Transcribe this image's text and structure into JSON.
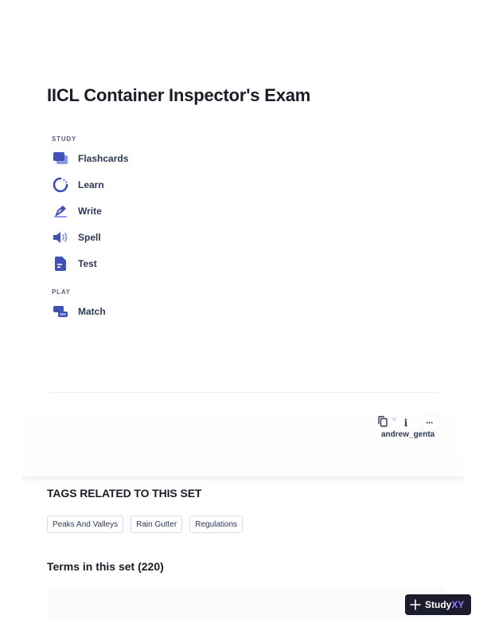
{
  "set": {
    "title": "IICL Container Inspector's Exam"
  },
  "study": {
    "section_label": "STUDY",
    "modes": [
      {
        "label": "Flashcards",
        "icon": "flashcards-icon"
      },
      {
        "label": "Learn",
        "icon": "learn-icon"
      },
      {
        "label": "Write",
        "icon": "write-icon"
      },
      {
        "label": "Spell",
        "icon": "spell-icon"
      },
      {
        "label": "Test",
        "icon": "test-icon"
      }
    ]
  },
  "play": {
    "section_label": "PLAY",
    "modes": [
      {
        "label": "Match",
        "icon": "match-icon"
      }
    ]
  },
  "creator": {
    "username": "andrew_genta",
    "tiny_mark": "st"
  },
  "actions": {
    "copy_icon": "copy-icon",
    "info_icon": "info-icon",
    "more_icon": "more-icon",
    "info_glyph": "i",
    "more_glyph": "•••"
  },
  "tags": {
    "heading": "TAGS RELATED TO THIS SET",
    "items": [
      "Peaks And Valleys",
      "Rain Gutter",
      "Regulations"
    ]
  },
  "terms": {
    "heading": "Terms in this set (220)"
  },
  "badge": {
    "brand": "Study",
    "brand_accent": "XY"
  },
  "colors": {
    "accent": "#4255ff",
    "icon_blue": "#3f51b5",
    "badge_bg": "#1c1d2c",
    "brand_accent": "#8f7cff"
  }
}
